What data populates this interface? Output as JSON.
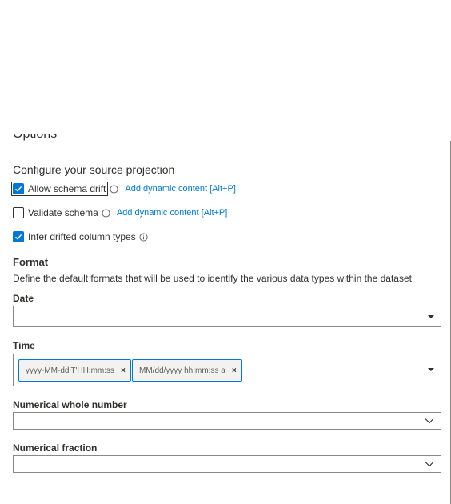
{
  "options_heading": "Options",
  "projection_title": "Configure your source projection",
  "checkboxes": [
    {
      "label": "Allow schema drift",
      "checked": true,
      "link": "Add dynamic content [Alt+P]"
    },
    {
      "label": "Validate schema",
      "checked": false,
      "link": "Add dynamic content [Alt+P]"
    },
    {
      "label": "Infer drifted column types",
      "checked": true,
      "link": ""
    }
  ],
  "format": {
    "title": "Format",
    "description": "Define the default formats that will be used to identify the various data types within the dataset"
  },
  "fields": {
    "date": {
      "label": "Date",
      "value": ""
    },
    "time": {
      "label": "Time",
      "tags": [
        "yyyy-MM-dd'T'HH:mm:ss",
        "MM/dd/yyyy hh:mm:ss a"
      ]
    },
    "whole_number": {
      "label": "Numerical whole number",
      "value": ""
    },
    "fraction": {
      "label": "Numerical fraction",
      "value": ""
    }
  },
  "colors": {
    "accent": "#0078d4",
    "border": "#8a8886",
    "text": "#323130"
  },
  "icons": {
    "info": "info-icon",
    "remove": "remove-tag-icon",
    "caret": "caret-down-icon",
    "chevron": "chevron-down-icon"
  }
}
